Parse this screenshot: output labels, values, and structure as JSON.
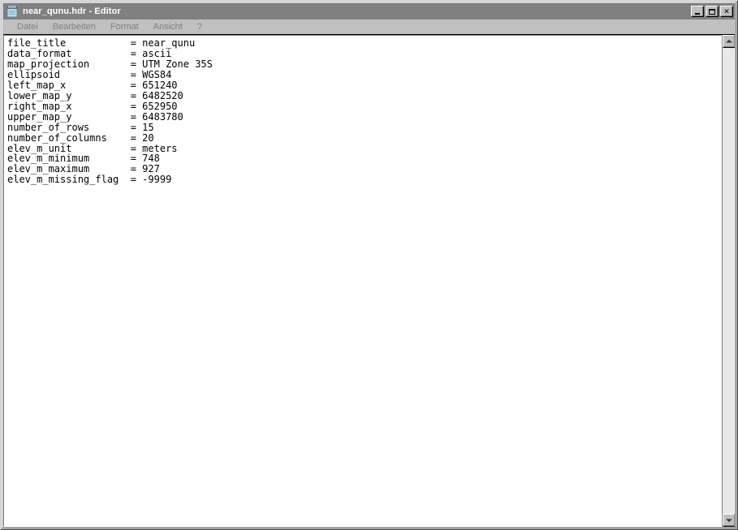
{
  "window": {
    "title": "near_qunu.hdr - Editor",
    "icon": "notepad-icon",
    "title_bar_color": "#808080",
    "title_text_color": "#ffffff",
    "face_color": "#c0c0c0",
    "text_area_background": "#ffffff",
    "text_color": "#000000"
  },
  "title_buttons": {
    "minimize": "_",
    "maximize": "□",
    "close": "✕"
  },
  "menubar": {
    "items": [
      {
        "label": "Datei"
      },
      {
        "label": "Bearbeiten"
      },
      {
        "label": "Format"
      },
      {
        "label": "Ansicht"
      },
      {
        "label": "?"
      }
    ]
  },
  "document": {
    "entries": [
      {
        "key": "file_title",
        "value": "near_qunu"
      },
      {
        "key": "data_format",
        "value": "ascii"
      },
      {
        "key": "map_projection",
        "value": "UTM Zone 35S"
      },
      {
        "key": "ellipsoid",
        "value": "WGS84"
      },
      {
        "key": "left_map_x",
        "value": "651240"
      },
      {
        "key": "lower_map_y",
        "value": "6482520"
      },
      {
        "key": "right_map_x",
        "value": "652950"
      },
      {
        "key": "upper_map_y",
        "value": "6483780"
      },
      {
        "key": "number_of_rows",
        "value": "15"
      },
      {
        "key": "number_of_columns",
        "value": "20"
      },
      {
        "key": "elev_m_unit",
        "value": "meters"
      },
      {
        "key": "elev_m_minimum",
        "value": "748"
      },
      {
        "key": "elev_m_maximum",
        "value": "927"
      },
      {
        "key": "elev_m_missing_flag",
        "value": "-9999"
      }
    ],
    "key_column_width": 21
  },
  "scrollbar": {
    "up_arrow": "up-arrow-icon",
    "down_arrow": "down-arrow-icon",
    "thumb_visible": false
  }
}
